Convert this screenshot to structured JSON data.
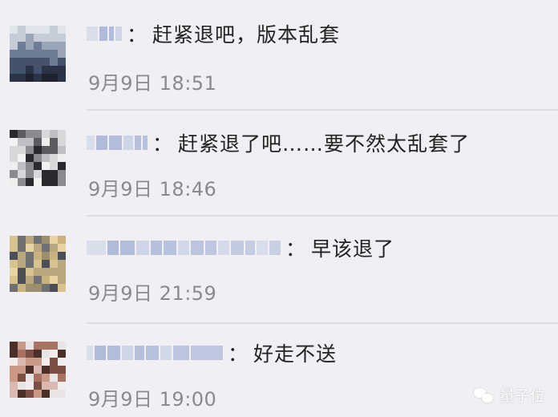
{
  "colors": {
    "background": "#f0f0f4",
    "text": "#222222",
    "time": "#8a8a8e",
    "divider": "#dcdce0",
    "blur_name": "#a9b6d6"
  },
  "comments": [
    {
      "avatar_icon": "user-avatar-icon",
      "colon": "：",
      "text": "赶紧退吧，版本乱套",
      "time": "9月9日 18:51"
    },
    {
      "avatar_icon": "user-avatar-icon",
      "colon": "：",
      "text": "赶紧退了吧……要不然太乱套了",
      "time": "9月9日 18:46"
    },
    {
      "avatar_icon": "user-avatar-icon",
      "colon": "：",
      "text": "早该退了",
      "time": "9月9日 21:59"
    },
    {
      "avatar_icon": "user-avatar-icon",
      "colon": "：",
      "text": "好走不送",
      "time": "9月9日 19:00"
    }
  ],
  "watermark": {
    "icon": "wechat-icon",
    "label": "量子位"
  }
}
